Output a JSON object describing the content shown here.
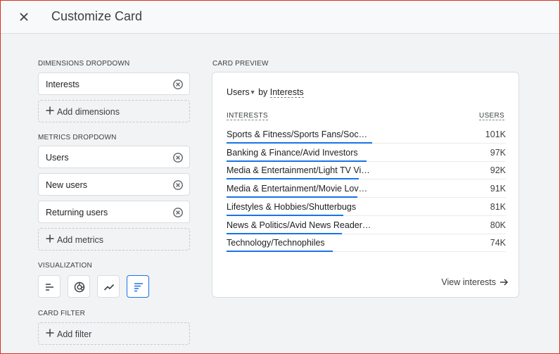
{
  "header": {
    "title": "Customize Card",
    "close_icon": "close-icon"
  },
  "dimensions": {
    "label": "DIMENSIONS DROPDOWN",
    "items": [
      "Interests"
    ],
    "add_label": "Add dimensions"
  },
  "metrics": {
    "label": "METRICS DROPDOWN",
    "items": [
      "Users",
      "New users",
      "Returning users"
    ],
    "add_label": "Add metrics"
  },
  "visualization": {
    "label": "VISUALIZATION",
    "options": [
      "bar-chart-icon",
      "donut-chart-icon",
      "line-chart-icon",
      "table-bar-icon"
    ],
    "selected": "table-bar-icon"
  },
  "card_filter": {
    "label": "CARD FILTER",
    "add_label": "Add filter"
  },
  "preview": {
    "label": "CARD PREVIEW",
    "metric": "Users",
    "by_text": "by",
    "dimension": "Interests",
    "col_dimension": "INTERESTS",
    "col_metric": "USERS",
    "rows": [
      {
        "label": "Sports & Fitness/Sports Fans/Soc…",
        "value": "101K",
        "fraction": 1.0
      },
      {
        "label": "Banking & Finance/Avid Investors",
        "value": "97K",
        "fraction": 0.96
      },
      {
        "label": "Media & Entertainment/Light TV Vi…",
        "value": "92K",
        "fraction": 0.91
      },
      {
        "label": "Media & Entertainment/Movie Lov…",
        "value": "91K",
        "fraction": 0.9
      },
      {
        "label": "Lifestyles & Hobbies/Shutterbugs",
        "value": "81K",
        "fraction": 0.8
      },
      {
        "label": "News & Politics/Avid News Reader…",
        "value": "80K",
        "fraction": 0.79
      },
      {
        "label": "Technology/Technophiles",
        "value": "74K",
        "fraction": 0.73
      }
    ],
    "view_link": "View interests"
  },
  "colors": {
    "accent": "#1a73e8",
    "frame": "#d93025"
  }
}
